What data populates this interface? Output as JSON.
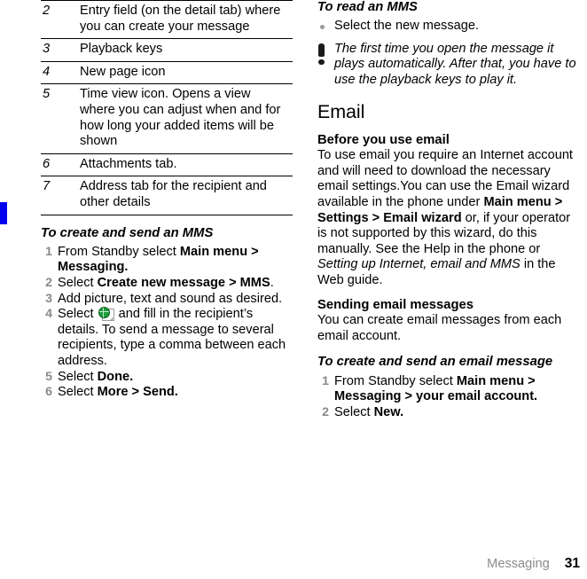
{
  "document": {
    "chapter": "Messaging",
    "page_number": "31"
  },
  "edge_tab": {
    "color": "#0000f0"
  },
  "left_column": {
    "reference_table": {
      "rows": [
        {
          "number": "2",
          "description": "Entry field (on the detail tab) where you can create your message"
        },
        {
          "number": "3",
          "description": "Playback keys"
        },
        {
          "number": "4",
          "description": "New page icon"
        },
        {
          "number": "5",
          "description": "Time view icon. Opens a view where you can adjust when and for how long your added items will be shown"
        },
        {
          "number": "6",
          "description": "Attachments tab."
        },
        {
          "number": "7",
          "description": "Address tab for the recipient and other details"
        }
      ]
    },
    "procedure": {
      "heading": "To create and send an MMS",
      "steps": [
        {
          "parts": [
            {
              "type": "plain",
              "text": "From Standby select "
            },
            {
              "type": "bold",
              "text": "Main menu > Messaging."
            }
          ]
        },
        {
          "parts": [
            {
              "type": "plain",
              "text": "Select "
            },
            {
              "type": "bold",
              "text": "Create new message > MMS"
            },
            {
              "type": "plain",
              "text": "."
            }
          ]
        },
        {
          "parts": [
            {
              "type": "plain",
              "text": "Add picture, text and sound as desired."
            }
          ]
        },
        {
          "parts": [
            {
              "type": "plain",
              "text": "Select "
            },
            {
              "type": "icon",
              "icon": "mms-recipient-icon"
            },
            {
              "type": "plain",
              "text": " and fill in the recipient’s details. To send a message to several recipients, type a comma between each address."
            }
          ]
        },
        {
          "parts": [
            {
              "type": "plain",
              "text": "Select "
            },
            {
              "type": "bold",
              "text": "Done."
            }
          ]
        },
        {
          "parts": [
            {
              "type": "plain",
              "text": "Select "
            },
            {
              "type": "bold",
              "text": "More > Send."
            }
          ]
        }
      ]
    }
  },
  "right_column": {
    "read_mms": {
      "heading": "To read an MMS",
      "bullets": [
        "Select the new message."
      ],
      "note": {
        "icon": "exclamation-icon",
        "text": "The first time you open the message it plays automatically. After that, you have to use the playback keys to play it."
      }
    },
    "email_section": {
      "heading": "Email",
      "before_you_use": {
        "heading": "Before you use email",
        "paragraph_parts": [
          {
            "type": "plain",
            "text": "To use email you require an Internet account and will need to download the necessary email settings.You can use the Email wizard available in the phone under "
          },
          {
            "type": "bold",
            "text": "Main menu > Settings > Email wizard"
          },
          {
            "type": "plain",
            "text": " or, if your operator is not supported by this wizard, do this manually. See the Help in the phone or "
          },
          {
            "type": "italic",
            "text": "Setting up Internet, email and MMS"
          },
          {
            "type": "plain",
            "text": " in the Web guide."
          }
        ]
      },
      "sending": {
        "heading": "Sending email messages",
        "paragraph": "You can create email messages from each email account."
      },
      "procedure": {
        "heading": "To create and send an email message",
        "steps": [
          {
            "parts": [
              {
                "type": "plain",
                "text": "From Standby select "
              },
              {
                "type": "bold",
                "text": "Main menu > Messaging > your email account."
              }
            ]
          },
          {
            "parts": [
              {
                "type": "plain",
                "text": "Select "
              },
              {
                "type": "bold",
                "text": "New."
              }
            ]
          }
        ]
      }
    }
  }
}
